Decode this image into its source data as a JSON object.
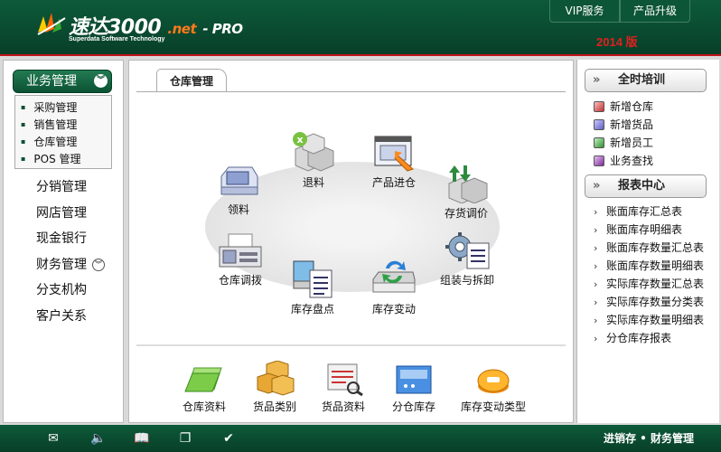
{
  "header": {
    "logo_main": "速达3000",
    "logo_net": ".net",
    "logo_pro": "- PRO",
    "logo_sub": "Superdata Software Technology",
    "links": [
      "VIP服务",
      "产品升级"
    ],
    "version": "2014 版"
  },
  "sidebar": {
    "head": "业务管理",
    "submenu": [
      "采购管理",
      "销售管理",
      "仓库管理",
      "POS 管理"
    ],
    "menu": [
      "分销管理",
      "网店管理",
      "现金银行",
      "财务管理",
      "分支机构",
      "客户关系"
    ]
  },
  "center": {
    "tab": "仓库管理",
    "nodes": {
      "receive": "领料",
      "return": "退料",
      "stock_in": "产品进仓",
      "price_adjust": "存货调价",
      "transfer": "仓库调拨",
      "inventory_check": "库存盘点",
      "stock_change": "库存变动",
      "assemble": "组装与拆卸"
    },
    "bottom": [
      "仓库资料",
      "货品类别",
      "货品资料",
      "分仓库存",
      "库存变动类型"
    ]
  },
  "right": {
    "training_head": "全时培训",
    "training": [
      "新增仓库",
      "新增货品",
      "新增员工",
      "业务查找"
    ],
    "report_head": "报表中心",
    "reports": [
      "账面库存汇总表",
      "账面库存明细表",
      "账面库存数量汇总表",
      "账面库存数量明细表",
      "实际库存数量汇总表",
      "实际库存数量分类表",
      "实际库存数量明细表",
      "分仓库存报表"
    ]
  },
  "footer": {
    "text": "进销存 • 财务管理"
  },
  "colors": {
    "header_green": "#0a4a30",
    "accent_red": "#c0141a",
    "version_red": "#e2201f",
    "logo_orange": "#ff7a1a"
  }
}
